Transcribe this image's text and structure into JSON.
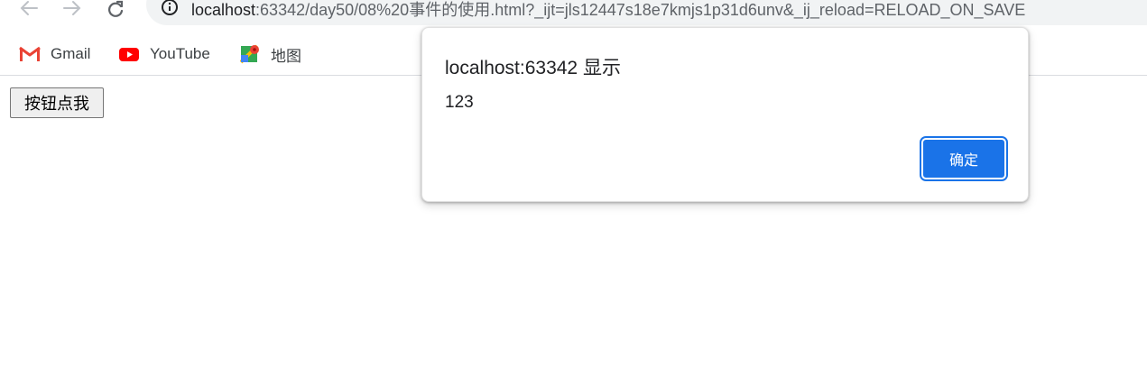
{
  "browser": {
    "url_host": "localhost",
    "url_rest": ":63342/day50/08%20事件的使用.html?_ijt=jls12447s18e7kmjs1p31d6unv&_ij_reload=RELOAD_ON_SAVE"
  },
  "bookmarks": [
    {
      "label": "Gmail",
      "icon": "gmail-icon"
    },
    {
      "label": "YouTube",
      "icon": "youtube-icon"
    },
    {
      "label": "地图",
      "icon": "maps-icon"
    }
  ],
  "page": {
    "button_label": "按钮点我"
  },
  "dialog": {
    "title": "localhost:63342 显示",
    "message": "123",
    "ok_label": "确定"
  },
  "colors": {
    "accent": "#1a73e8",
    "omnibox_bg": "#f1f3f4"
  }
}
